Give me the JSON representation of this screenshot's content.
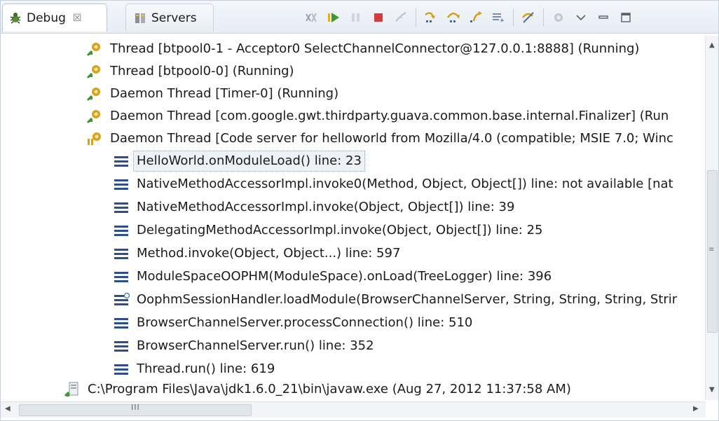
{
  "tabs": {
    "debug_label": "Debug",
    "debug_close": "☒",
    "servers_label": "Servers"
  },
  "toolbar": {
    "buttons": [
      "remove-all-terminated",
      "resume",
      "suspend",
      "terminate",
      "disconnect",
      "step-into",
      "step-over",
      "step-return",
      "drop-to-frame",
      "use-step-filters",
      "instruction-stepping",
      "view-menu",
      "minimize",
      "maximize"
    ]
  },
  "tree": {
    "threads": [
      "Thread [btpool0-1 - Acceptor0 SelectChannelConnector@127.0.0.1:8888] (Running)",
      "Thread [btpool0-0] (Running)",
      "Daemon Thread [Timer-0] (Running)",
      "Daemon Thread [com.google.gwt.thirdparty.guava.common.base.internal.Finalizer] (Run",
      "Daemon Thread [Code server for helloworld from Mozilla/4.0 (compatible; MSIE 7.0; Winc"
    ],
    "frames": [
      "HelloWorld.onModuleLoad() line: 23",
      "NativeMethodAccessorImpl.invoke0(Method, Object, Object[]) line: not available [nat",
      "NativeMethodAccessorImpl.invoke(Object, Object[]) line: 39",
      "DelegatingMethodAccessorImpl.invoke(Object, Object[]) line: 25",
      "Method.invoke(Object, Object...) line: 597",
      "ModuleSpaceOOPHM(ModuleSpace).onLoad(TreeLogger) line: 396",
      "OophmSessionHandler.loadModule(BrowserChannelServer, String, String, String, Strir",
      "BrowserChannelServer.processConnection() line: 510",
      "BrowserChannelServer.run() line: 352",
      "Thread.run() line: 619"
    ],
    "process": "C:\\Program Files\\Java\\jdk1.6.0_21\\bin\\javaw.exe (Aug 27, 2012 11:37:58 AM)"
  },
  "scrollbar": {
    "h_grip": "III"
  },
  "colors": {
    "frame_icon": "#2e4f8f",
    "thread_icon": "#d9a21a",
    "terminate": "#d83b3b",
    "resume": "#3a9a2f"
  }
}
